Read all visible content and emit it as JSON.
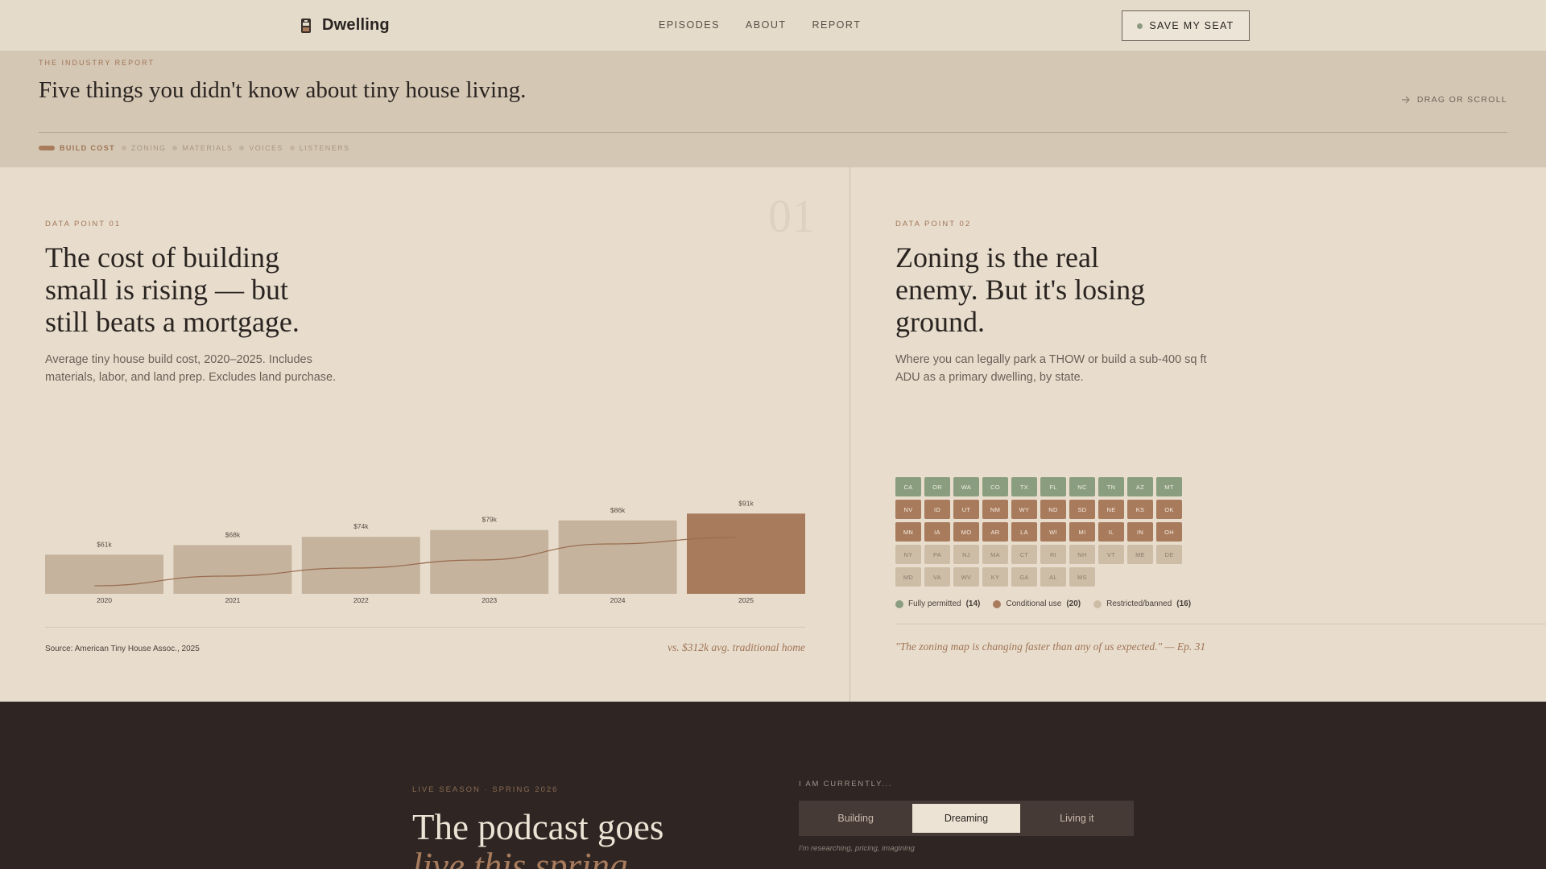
{
  "nav": {
    "brand": "Dwelling",
    "links": [
      "EPISODES",
      "ABOUT",
      "REPORT"
    ],
    "cta": "SAVE MY SEAT"
  },
  "report": {
    "eyebrow": "THE INDUSTRY REPORT",
    "title": "Five things you didn't know about tiny house living.",
    "hint": "DRAG OR SCROLL",
    "tabs": [
      "BUILD COST",
      "ZONING",
      "MATERIALS",
      "VOICES",
      "LISTENERS"
    ],
    "active_tab": "BUILD COST"
  },
  "point1": {
    "label": "DATA POINT 01",
    "number": "01",
    "title_lines": [
      "The cost of building",
      "small is rising — but",
      "still beats a mortgage."
    ],
    "desc_lines": [
      "Average tiny house build cost, 2020–2025. Includes",
      "materials, labor, and land prep. Excludes land purchase."
    ],
    "source": "Source: American Tiny House Assoc., 2025",
    "comparison": "vs. $312k avg. traditional home"
  },
  "chart_data": {
    "type": "bar",
    "title": "",
    "xlabel": "",
    "ylabel": "",
    "categories": [
      "2020",
      "2021",
      "2022",
      "2023",
      "2024",
      "2025"
    ],
    "values": [
      61,
      68,
      74,
      79,
      86,
      91
    ],
    "value_labels": [
      "$61k",
      "$68k",
      "$74k",
      "$79k",
      "$86k",
      "$91k"
    ],
    "units": "thousand USD",
    "highlight": "2025",
    "trend_line": true,
    "colors": {
      "bar": "#c5b39d",
      "highlight": "#a87b5c",
      "line": "#9a6e52"
    }
  },
  "point2": {
    "label": "DATA POINT 02",
    "title_lines": [
      "Zoning is the real",
      "enemy. But it's losing",
      "ground."
    ],
    "desc_lines": [
      "Where you can legally park a THOW or build a sub-400 sq ft",
      "ADU as a primary dwelling, by state."
    ],
    "states": [
      {
        "code": "CA",
        "status": "permitted"
      },
      {
        "code": "OR",
        "status": "permitted"
      },
      {
        "code": "WA",
        "status": "permitted"
      },
      {
        "code": "CO",
        "status": "permitted"
      },
      {
        "code": "TX",
        "status": "permitted"
      },
      {
        "code": "FL",
        "status": "permitted"
      },
      {
        "code": "NC",
        "status": "permitted"
      },
      {
        "code": "TN",
        "status": "permitted"
      },
      {
        "code": "AZ",
        "status": "permitted"
      },
      {
        "code": "MT",
        "status": "permitted"
      },
      {
        "code": "NV",
        "status": "conditional"
      },
      {
        "code": "ID",
        "status": "conditional"
      },
      {
        "code": "UT",
        "status": "conditional"
      },
      {
        "code": "NM",
        "status": "conditional"
      },
      {
        "code": "WY",
        "status": "conditional"
      },
      {
        "code": "ND",
        "status": "conditional"
      },
      {
        "code": "SD",
        "status": "conditional"
      },
      {
        "code": "NE",
        "status": "conditional"
      },
      {
        "code": "KS",
        "status": "conditional"
      },
      {
        "code": "OK",
        "status": "conditional"
      },
      {
        "code": "MN",
        "status": "conditional"
      },
      {
        "code": "IA",
        "status": "conditional"
      },
      {
        "code": "MO",
        "status": "conditional"
      },
      {
        "code": "AR",
        "status": "conditional"
      },
      {
        "code": "LA",
        "status": "conditional"
      },
      {
        "code": "WI",
        "status": "conditional"
      },
      {
        "code": "MI",
        "status": "conditional"
      },
      {
        "code": "IL",
        "status": "conditional"
      },
      {
        "code": "IN",
        "status": "conditional"
      },
      {
        "code": "OH",
        "status": "conditional"
      },
      {
        "code": "NY",
        "status": "restricted"
      },
      {
        "code": "PA",
        "status": "restricted"
      },
      {
        "code": "NJ",
        "status": "restricted"
      },
      {
        "code": "MA",
        "status": "restricted"
      },
      {
        "code": "CT",
        "status": "restricted"
      },
      {
        "code": "RI",
        "status": "restricted"
      },
      {
        "code": "NH",
        "status": "restricted"
      },
      {
        "code": "VT",
        "status": "restricted"
      },
      {
        "code": "ME",
        "status": "restricted"
      },
      {
        "code": "DE",
        "status": "restricted"
      },
      {
        "code": "MD",
        "status": "restricted"
      },
      {
        "code": "VA",
        "status": "restricted"
      },
      {
        "code": "WV",
        "status": "restricted"
      },
      {
        "code": "KY",
        "status": "restricted"
      },
      {
        "code": "GA",
        "status": "restricted"
      },
      {
        "code": "AL",
        "status": "restricted"
      },
      {
        "code": "MS",
        "status": "restricted"
      }
    ],
    "legend": [
      {
        "label": "Fully permitted",
        "count": "(14)",
        "color": "#8a9e7f"
      },
      {
        "label": "Conditional use",
        "count": "(20)",
        "color": "#a87b5c"
      },
      {
        "label": "Restricted/banned",
        "count": "(16)",
        "color": "#cdbda6"
      }
    ],
    "quote": "\"The zoning map is changing faster than any of us expected.\" — Ep. 31"
  },
  "live": {
    "eyebrow": "LIVE SEASON · SPRING 2026",
    "title": "The podcast goes",
    "title_italic": "live this spring",
    "current_label": "I AM CURRENTLY...",
    "options": [
      "Building",
      "Dreaming",
      "Living it"
    ],
    "selected": "Dreaming",
    "note": "I'm researching, pricing, imagining"
  }
}
